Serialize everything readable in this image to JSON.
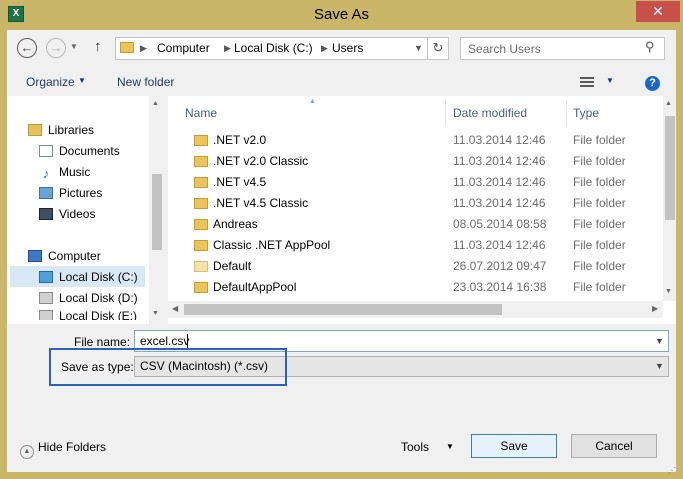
{
  "window": {
    "title": "Save As",
    "app_icon": "excel-icon",
    "close_glyph": "✕"
  },
  "nav": {
    "back_glyph": "←",
    "forward_glyph": "→",
    "up_glyph": "↑",
    "breadcrumbs": [
      "Computer",
      "Local Disk (C:)",
      "Users"
    ],
    "refresh_glyph": "↻",
    "search_placeholder": "Search Users"
  },
  "toolbar": {
    "organize_label": "Organize",
    "new_folder_label": "New folder",
    "help_glyph": "?"
  },
  "sidebar": {
    "items": [
      {
        "label": "Libraries",
        "icon": "libraries-icon"
      },
      {
        "label": "Documents",
        "icon": "documents-icon"
      },
      {
        "label": "Music",
        "icon": "music-icon"
      },
      {
        "label": "Pictures",
        "icon": "pictures-icon"
      },
      {
        "label": "Videos",
        "icon": "videos-icon"
      },
      {
        "label": "Computer",
        "icon": "computer-icon"
      },
      {
        "label": "Local Disk (C:)",
        "icon": "drive-icon",
        "selected": true
      },
      {
        "label": "Local Disk (D:)",
        "icon": "drive-icon"
      },
      {
        "label": "Local Disk (E:)",
        "icon": "drive-icon"
      }
    ]
  },
  "files": {
    "columns": [
      "Name",
      "Date modified",
      "Type"
    ],
    "rows": [
      {
        "name": ".NET v2.0",
        "date": "11.03.2014 12:46",
        "type": "File folder"
      },
      {
        "name": ".NET v2.0 Classic",
        "date": "11.03.2014 12:46",
        "type": "File folder"
      },
      {
        "name": ".NET v4.5",
        "date": "11.03.2014 12:46",
        "type": "File folder"
      },
      {
        "name": ".NET v4.5 Classic",
        "date": "11.03.2014 12:46",
        "type": "File folder"
      },
      {
        "name": "Andreas",
        "date": "08.05.2014 08:58",
        "type": "File folder"
      },
      {
        "name": "Classic .NET AppPool",
        "date": "11.03.2014 12:46",
        "type": "File folder"
      },
      {
        "name": "Default",
        "date": "26.07.2012 09:47",
        "type": "File folder"
      },
      {
        "name": "DefaultAppPool",
        "date": "23.03.2014 16:38",
        "type": "File folder"
      }
    ]
  },
  "form": {
    "file_name_label": "File name:",
    "file_name_value": "excel.csv",
    "save_type_label": "Save as type:",
    "save_type_value": "CSV (Macintosh) (*.csv)"
  },
  "footer": {
    "hide_folders_label": "Hide Folders",
    "tools_label": "Tools",
    "save_label": "Save",
    "cancel_label": "Cancel"
  },
  "colors": {
    "frame": "#c9b668",
    "close": "#c7504a",
    "highlight": "#2c64b5",
    "selection": "#d9e8f7"
  }
}
